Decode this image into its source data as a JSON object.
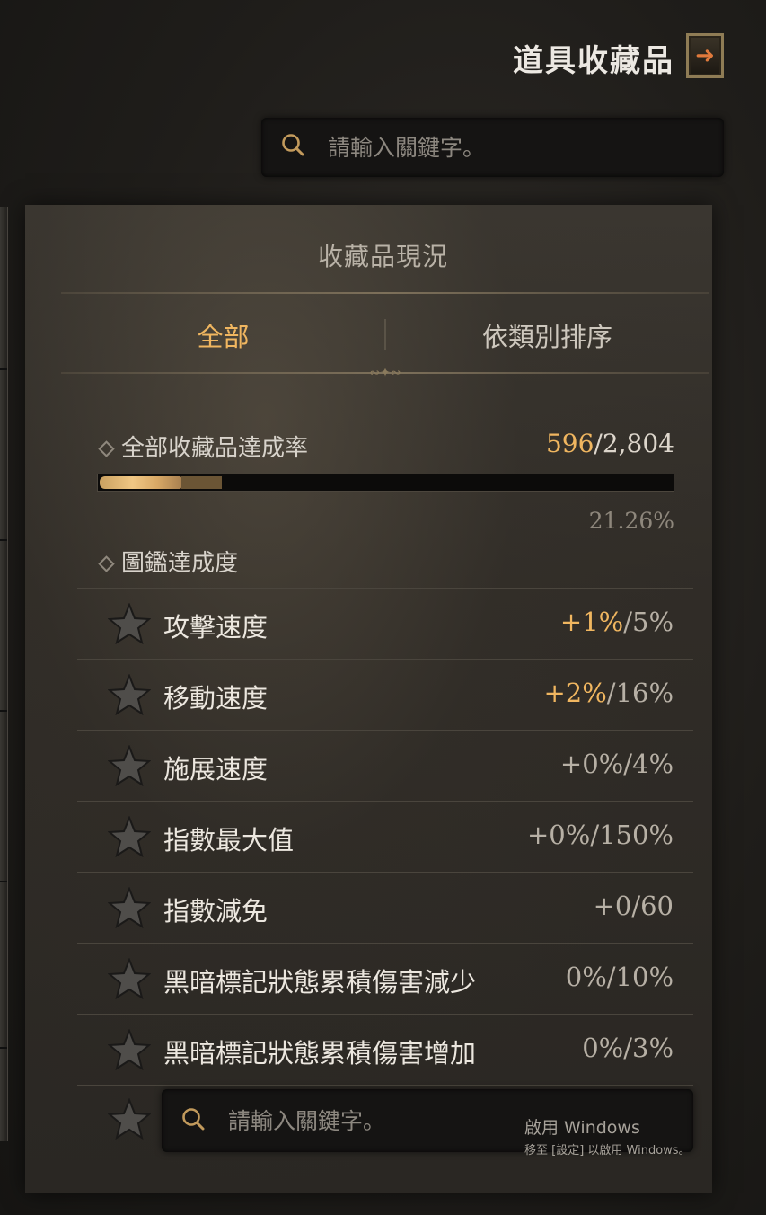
{
  "header": {
    "title": "道具收藏品",
    "exit_icon": "exit-arrow-icon"
  },
  "search": {
    "placeholder": "請輸入關鍵字。"
  },
  "panel": {
    "title": "收藏品現況",
    "tabs": [
      {
        "label": "全部",
        "active": true
      },
      {
        "label": "依類別排序",
        "active": false
      }
    ]
  },
  "completion": {
    "label": "全部收藏品達成率",
    "current": "596",
    "total": "/2,804",
    "percent": "21.26%",
    "progress_fraction": 0.2126,
    "extra_fraction": 0.07
  },
  "codex": {
    "label": "圖鑑達成度",
    "bonuses": [
      {
        "name": "攻擊速度",
        "bonus": "+1%",
        "max": "/5%",
        "active": true
      },
      {
        "name": "移動速度",
        "bonus": "+2%",
        "max": "/16%",
        "active": true
      },
      {
        "name": "施展速度",
        "bonus": "+0%",
        "max": "/4%",
        "active": false
      },
      {
        "name": "指數最大值",
        "bonus": "+0%",
        "max": "/150%",
        "active": false
      },
      {
        "name": "指數減免",
        "bonus": "+0",
        "max": "/60",
        "active": false
      },
      {
        "name": "黑暗標記狀態累積傷害減少",
        "bonus": "0%",
        "max": "/10%",
        "active": false
      },
      {
        "name": "黑暗標記狀態累積傷害增加",
        "bonus": "0%",
        "max": "/3%",
        "active": false
      }
    ]
  },
  "windows_watermark": {
    "line1": "啟用 Windows",
    "line2": "移至 [設定] 以啟用 Windows。"
  },
  "colors": {
    "accent": "#f0b660",
    "text": "#d8d3cb",
    "muted": "#8e877c"
  }
}
